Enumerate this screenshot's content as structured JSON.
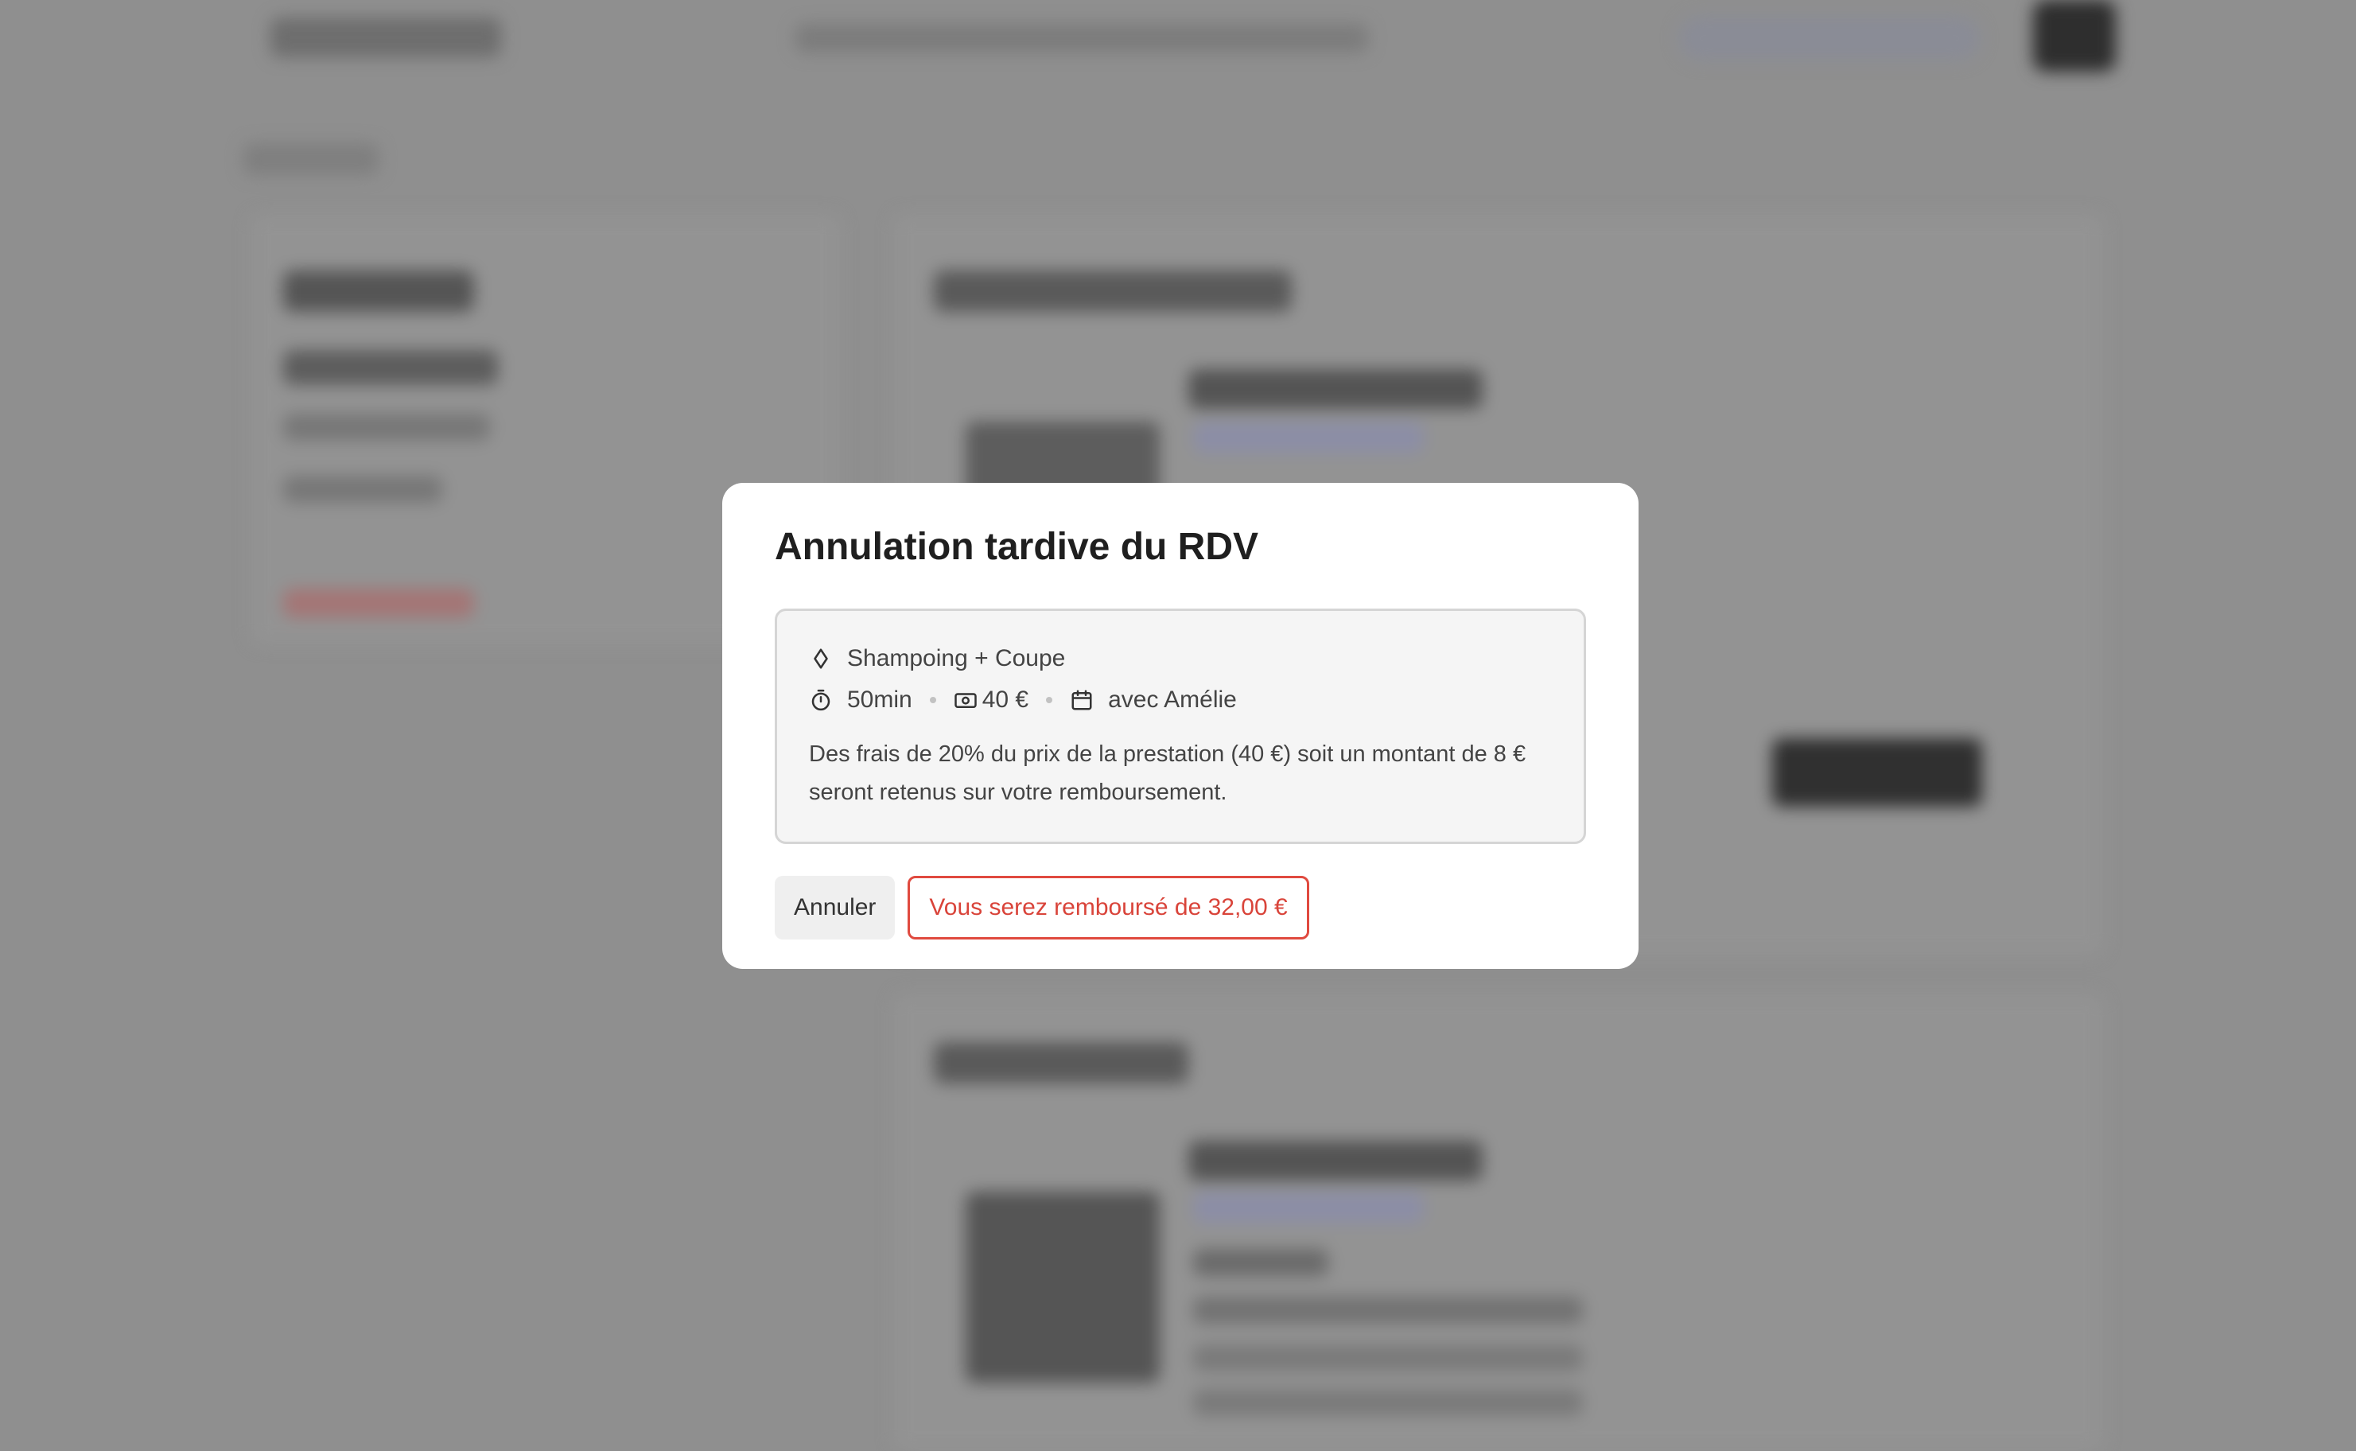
{
  "modal": {
    "title": "Annulation tardive du RDV",
    "service_name": "Shampoing + Coupe",
    "duration": "50min",
    "price": "40 €",
    "staff": "avec Amélie",
    "note": "Des frais de 20% du prix de la prestation (40 €) soit un montant de 8 € seront retenus sur votre remboursement.",
    "cancel_label": "Annuler",
    "confirm_label": "Vous serez remboursé de 32,00 €"
  },
  "colors": {
    "accent_red": "#e04a3f",
    "overlay": "#8f8f8f"
  },
  "icons": {
    "service": "sparkle-icon",
    "duration": "timer-icon",
    "price": "banknote-icon",
    "staff": "calendar-icon"
  }
}
